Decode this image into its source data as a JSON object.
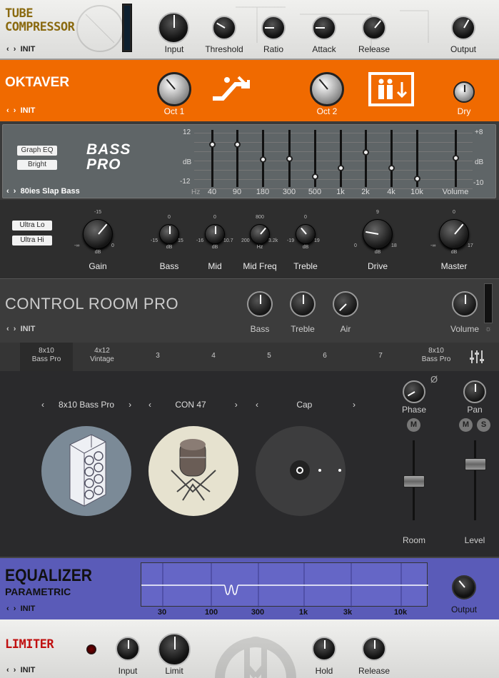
{
  "tube_compressor": {
    "title_line1": "TUBE",
    "title_line2": "COMPRESSOR",
    "preset": "INIT",
    "knobs": [
      "Input",
      "Threshold",
      "Ratio",
      "Attack",
      "Release",
      "Output"
    ]
  },
  "oktaver": {
    "title": "OKTAVER",
    "preset": "INIT",
    "knobs": [
      "Oct 1",
      "Oct 2",
      "Dry"
    ]
  },
  "bass_pro": {
    "tag_graph_eq": "Graph EQ",
    "tag_bright": "Bright",
    "logo_line1": "BASS",
    "logo_line2": "PRO",
    "preset": "80ies Slap Bass",
    "eq_scale_left_top": "12",
    "eq_scale_left_mid": "dB",
    "eq_scale_left_bottom": "-12",
    "eq_scale_right_top": "+8",
    "eq_scale_right_mid": "dB",
    "eq_scale_right_bottom": "-10",
    "eq_hz": "Hz",
    "eq_bands": [
      "40",
      "90",
      "180",
      "300",
      "500",
      "1k",
      "2k",
      "4k",
      "10k",
      "Volume"
    ],
    "eq_levels": [
      0.22,
      0.22,
      0.5,
      0.48,
      0.82,
      0.66,
      0.36,
      0.66,
      0.86,
      0.47
    ],
    "tag_ultra_lo": "Ultra Lo",
    "tag_ultra_hi": "Ultra Hi",
    "knobs": [
      {
        "label": "Gain",
        "top": "-15",
        "min": "-∞",
        "unit": "dB",
        "max": "0"
      },
      {
        "label": "Bass",
        "top": "0",
        "min": "-15",
        "unit": "dB",
        "max": "15"
      },
      {
        "label": "Mid",
        "top": "0",
        "min": "-16",
        "unit": "dB",
        "max": "10.7"
      },
      {
        "label": "Mid Freq",
        "top": "800",
        "min": "200",
        "unit": "Hz",
        "max": "3.2k"
      },
      {
        "label": "Treble",
        "top": "0",
        "min": "-19",
        "unit": "dB",
        "max": "19"
      },
      {
        "label": "Drive",
        "top": "9",
        "min": "0",
        "unit": "dB",
        "max": "18"
      },
      {
        "label": "Master",
        "top": "0",
        "min": "-∞",
        "unit": "dB",
        "max": "17"
      }
    ]
  },
  "control_room": {
    "title": "CONTROL ROOM PRO",
    "preset": "INIT",
    "knobs": [
      "Bass",
      "Treble",
      "Air",
      "Volume"
    ],
    "tabs": [
      {
        "line1": "8x10",
        "line2": "Bass Pro"
      },
      {
        "line1": "4x12",
        "line2": "Vintage"
      },
      {
        "line1": "3",
        "line2": ""
      },
      {
        "line1": "4",
        "line2": ""
      },
      {
        "line1": "5",
        "line2": ""
      },
      {
        "line1": "6",
        "line2": ""
      },
      {
        "line1": "7",
        "line2": ""
      },
      {
        "line1": "8x10",
        "line2": "Bass Pro"
      }
    ],
    "cabinet": "8x10 Bass Pro",
    "mic": "CON 47",
    "position": "Cap",
    "phase_label": "Phase",
    "pan_label": "Pan",
    "phase_symbol": "Ø",
    "mute_label": "M",
    "solo_label": "S",
    "room_label": "Room",
    "level_label": "Level"
  },
  "equalizer": {
    "title_line1": "EQUALIZER",
    "title_line2": "PARAMETRIC",
    "preset": "INIT",
    "freqs": [
      "30",
      "100",
      "300",
      "1k",
      "3k",
      "10k"
    ],
    "output_label": "Output"
  },
  "limiter": {
    "title": "LIMITER",
    "preset": "INIT",
    "knobs": [
      "Input",
      "Limit",
      "Hold",
      "Release"
    ]
  },
  "colors": {
    "oktaver_orange": "#f06a00",
    "tube_title": "#8a6a10",
    "eq_purple": "#5a5bb8",
    "limiter_red": "#c01010"
  }
}
